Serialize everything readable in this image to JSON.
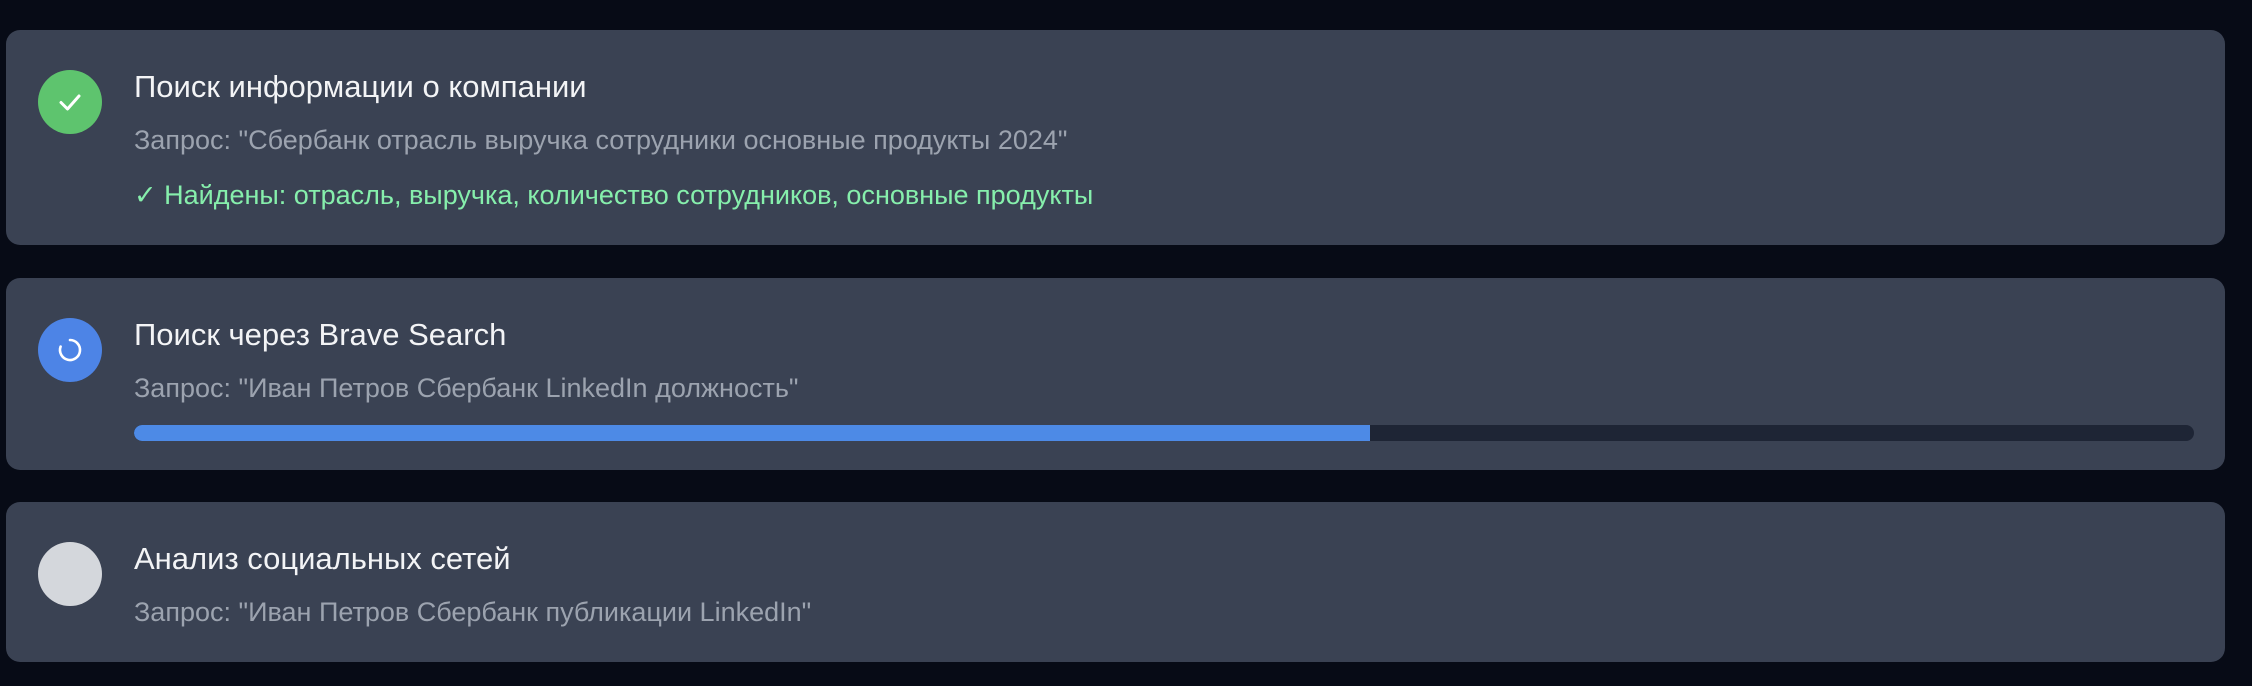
{
  "steps": [
    {
      "status": "done",
      "status_icon": "check-icon",
      "status_color": "#5ec46e",
      "title": "Поиск информации о компании",
      "query": "Запрос: \"Сбербанк отрасль выручка сотрудники основные продукты 2024\"",
      "result": "✓ Найдены: отрасль, выручка, количество сотрудников, основные продукты"
    },
    {
      "status": "in-progress",
      "status_icon": "spinner-icon",
      "status_color": "#4d84e6",
      "title": "Поиск через Brave Search",
      "query": "Запрос: \"Иван Петров Сбербанк LinkedIn должность\"",
      "progress": 0.6
    },
    {
      "status": "pending",
      "status_icon": "pending-circle-icon",
      "status_color": "#d4d7dc",
      "title": "Анализ социальных сетей",
      "query": "Запрос: \"Иван Петров Сбербанк публикации LinkedIn\""
    }
  ]
}
